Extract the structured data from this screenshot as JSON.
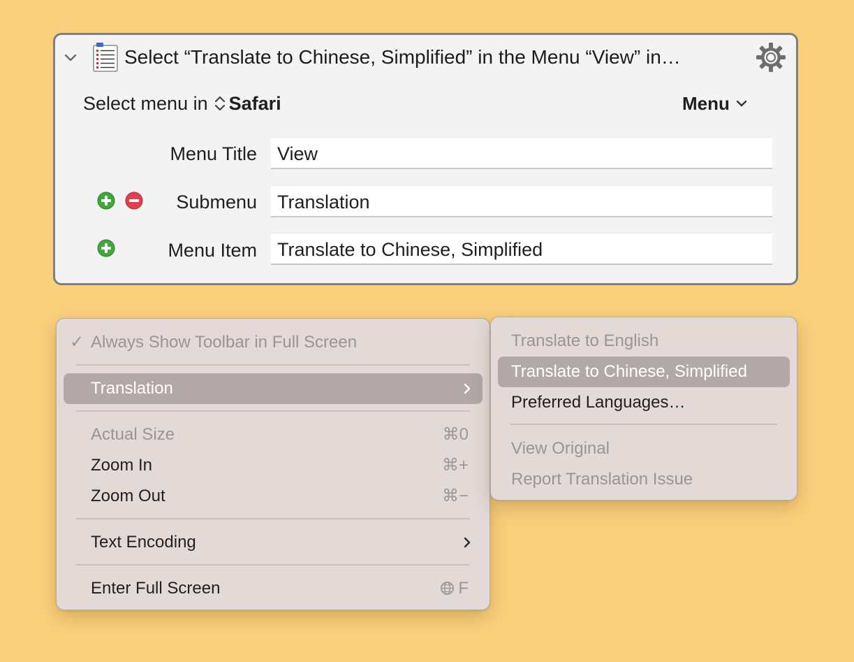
{
  "action": {
    "title": "Select “Translate to Chinese, Simplified” in the Menu “View” in…",
    "target_prefix": "Select menu in",
    "target_app": "Safari",
    "mode_dropdown": "Menu",
    "fields": [
      {
        "label": "Menu Title",
        "value": "View"
      },
      {
        "label": "Submenu",
        "value": "Translation"
      },
      {
        "label": "Menu Item",
        "value": "Translate to Chinese, Simplified"
      }
    ]
  },
  "view_menu": {
    "items": [
      {
        "label": "Always Show Toolbar in Full Screen",
        "checked": true,
        "enabled": false
      },
      {
        "label": "Translation",
        "submenu": true,
        "selected": true
      },
      {
        "label": "Actual Size",
        "shortcut": "⌘0",
        "enabled": false
      },
      {
        "label": "Zoom In",
        "shortcut": "⌘+"
      },
      {
        "label": "Zoom Out",
        "shortcut": "⌘−"
      },
      {
        "label": "Text Encoding",
        "submenu": true
      },
      {
        "label": "Enter Full Screen",
        "shortcut": "F"
      }
    ],
    "checkmark": "✓"
  },
  "translation_menu": {
    "items": [
      {
        "label": "Translate to English",
        "enabled": false
      },
      {
        "label": "Translate to Chinese, Simplified",
        "selected": true
      },
      {
        "label": "Preferred Languages…"
      },
      {
        "label": "View Original",
        "enabled": false
      },
      {
        "label": "Report Translation Issue",
        "enabled": false
      }
    ]
  },
  "colors": {
    "background": "#fad07c",
    "add_button": "#3ea83a",
    "remove_button": "#e0404d",
    "menu_highlight": "#b1a8a7"
  },
  "icons": [
    "chevron-down-icon",
    "document-list-icon",
    "gear-icon",
    "up-down-icon",
    "add-icon",
    "remove-icon",
    "chevron-right-icon",
    "globe-icon"
  ]
}
